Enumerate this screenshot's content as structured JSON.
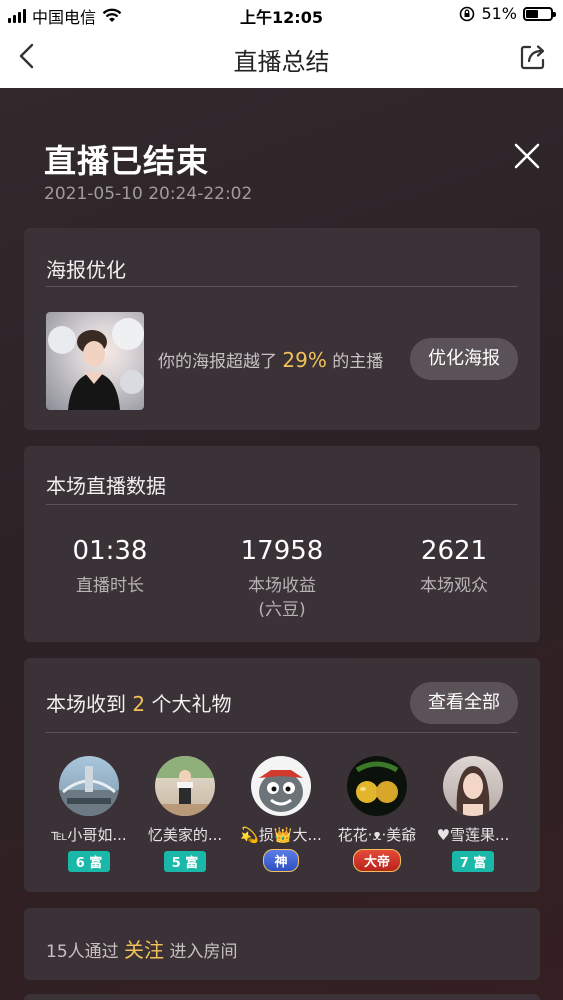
{
  "status_bar": {
    "carrier": "中国电信",
    "time": "上午12:05",
    "battery": "51%",
    "battery_fraction": 0.51
  },
  "nav": {
    "title": "直播总结"
  },
  "header": {
    "title": "直播已结束",
    "time_range": "2021-05-10 20:24-22:02"
  },
  "poster": {
    "heading": "海报优化",
    "text_before": "你的海报超越了",
    "percent": "29%",
    "text_after": "的主播",
    "button": "优化海报"
  },
  "stats": {
    "heading": "本场直播数据",
    "items": [
      {
        "value": "01:38",
        "label": "直播时长",
        "sublabel": ""
      },
      {
        "value": "17958",
        "label": "本场收益",
        "sublabel": "(六豆)"
      },
      {
        "value": "2621",
        "label": "本场观众",
        "sublabel": ""
      }
    ]
  },
  "gifts": {
    "heading_prefix": "本场收到",
    "count": "2",
    "heading_suffix": "个大礼物",
    "view_all": "查看全部",
    "gifters": [
      {
        "name": "℡小哥如...",
        "badge": "6 富",
        "badge_type": "rich"
      },
      {
        "name": "忆美家的...",
        "badge": "5 富",
        "badge_type": "rich"
      },
      {
        "name": "💫损👑大...",
        "badge": "神",
        "badge_type": "god"
      },
      {
        "name": "花花·ᴥ·美爺",
        "badge": "大帝",
        "badge_type": "emperor"
      },
      {
        "name": "♥雪莲果...",
        "badge": "7 富",
        "badge_type": "rich"
      }
    ]
  },
  "follow": {
    "text_before": "15人通过",
    "highlight": "关注",
    "text_after": "进入房间"
  }
}
